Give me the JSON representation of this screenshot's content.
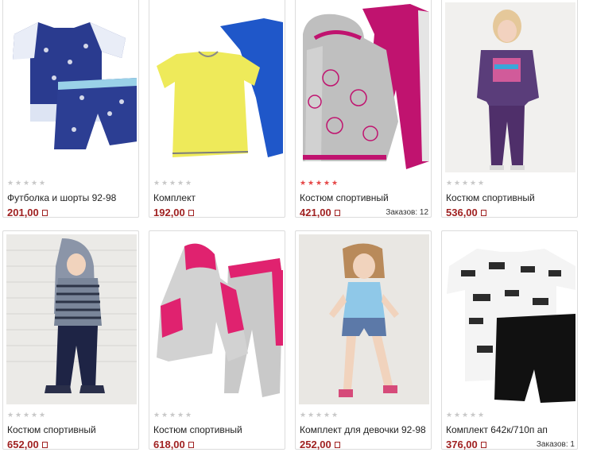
{
  "products": [
    {
      "title": "Футболка и шорты 92-98",
      "price": "201,00",
      "rating": 0,
      "orders": "",
      "image": "tshirt-shorts-blue"
    },
    {
      "title": "Комплект",
      "price": "192,00",
      "rating": 0,
      "orders": "",
      "image": "yellow-shirt-blue-pants"
    },
    {
      "title": "Костюм спортивный",
      "price": "421,00",
      "rating": 5,
      "orders": "Заказов: 12",
      "image": "grey-hoodie-pink-pants"
    },
    {
      "title": "Костюм спортивный",
      "price": "536,00",
      "rating": 0,
      "orders": "",
      "image": "girl-purple-suit"
    },
    {
      "title": "Костюм спортивный",
      "price": "652,00",
      "rating": 0,
      "orders": "",
      "image": "boy-striped-hoodie"
    },
    {
      "title": "Костюм спортивный",
      "price": "618,00",
      "rating": 0,
      "orders": "",
      "image": "pink-grey-tracksuit"
    },
    {
      "title": "Комплект для девочки 92-98",
      "price": "252,00",
      "rating": 0,
      "orders": "",
      "image": "girl-blue-top-shorts"
    },
    {
      "title": "Комплект 642к/710п ап",
      "price": "376,00",
      "rating": 0,
      "orders": "Заказов: 1",
      "image": "print-shirt-black-shorts"
    }
  ],
  "colors": {
    "price": "#a02222",
    "star_on": "#e54848",
    "star_off": "#c8c8c8",
    "border": "#dcdcdc"
  },
  "currency_icon": "currency-icon"
}
